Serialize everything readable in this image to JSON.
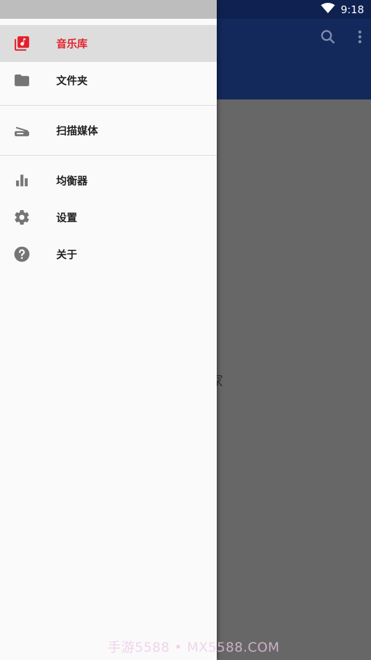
{
  "status_bar": {
    "time": "9:18",
    "wifi_icon": "wifi-icon"
  },
  "app_bar": {
    "color": "#14295b",
    "actions": [
      {
        "icon": "search-icon"
      },
      {
        "icon": "more-vert-icon"
      }
    ]
  },
  "background": {
    "partial_text": "家"
  },
  "drawer": {
    "accent_color": "#e5202a",
    "items": [
      {
        "label": "音乐库",
        "icon": "library-music-icon",
        "active": true
      },
      {
        "label": "文件夹",
        "icon": "folder-icon",
        "active": false
      },
      {
        "label": "扫描媒体",
        "icon": "scanner-icon",
        "active": false
      },
      {
        "label": "均衡器",
        "icon": "equalizer-icon",
        "active": false
      },
      {
        "label": "设置",
        "icon": "gear-icon",
        "active": false
      },
      {
        "label": "关于",
        "icon": "help-icon",
        "active": false
      }
    ]
  },
  "watermark": "手游5588 • MX5588.COM"
}
